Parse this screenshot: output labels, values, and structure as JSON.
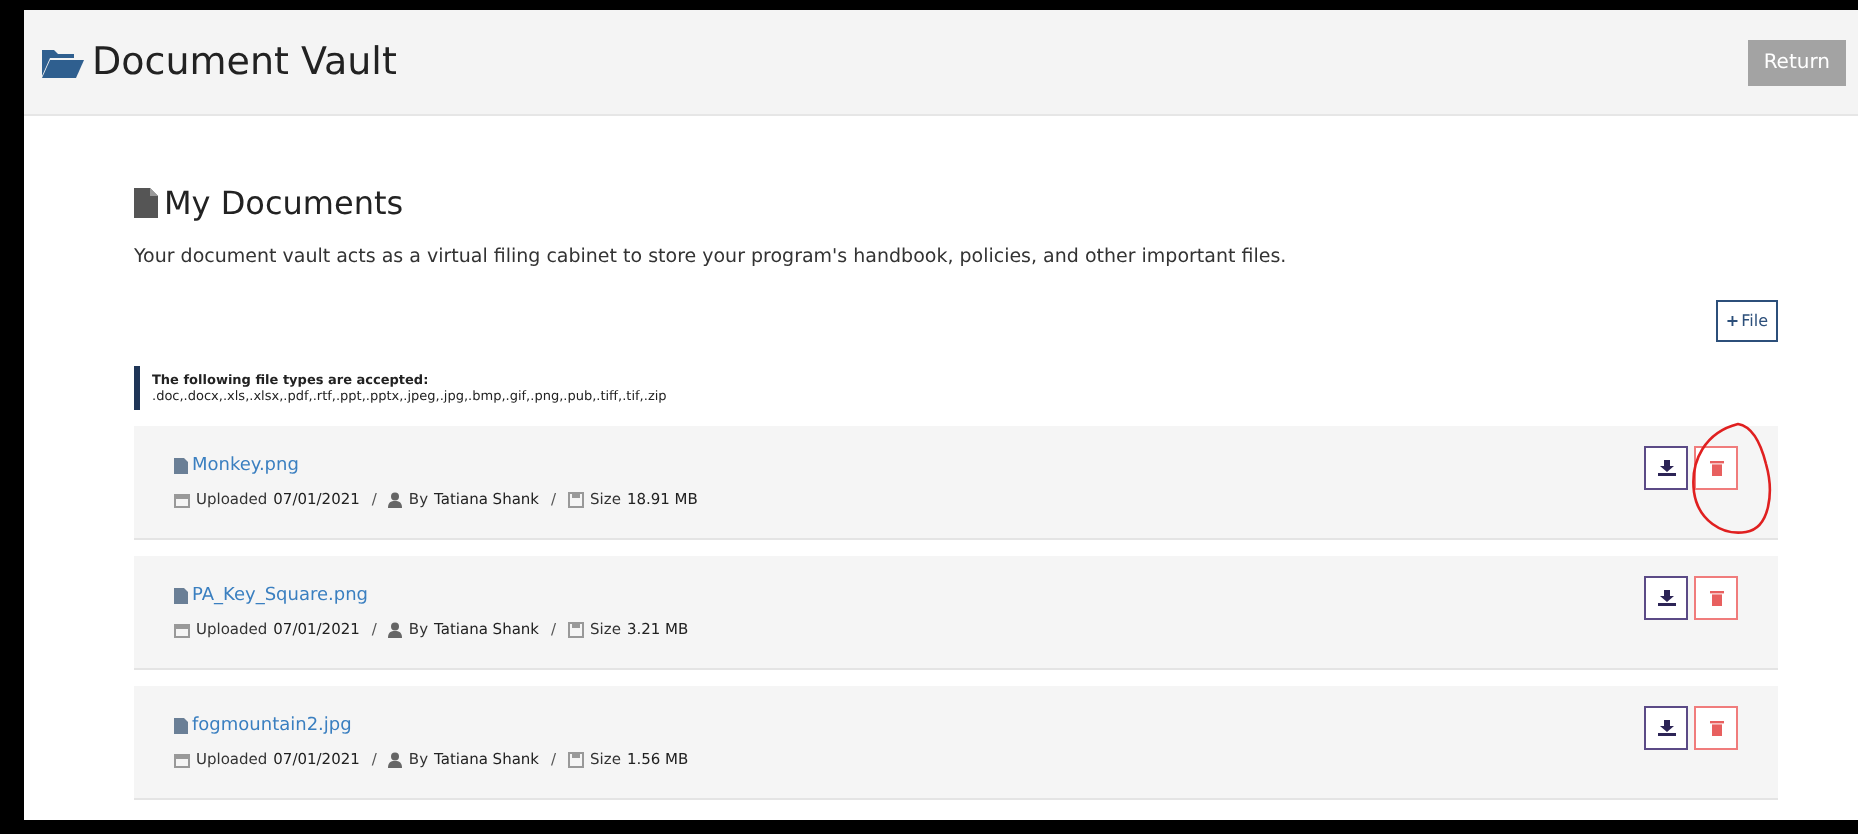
{
  "header": {
    "title": "Document Vault",
    "return_button": "Return"
  },
  "section": {
    "title": "My Documents",
    "description": "Your document vault acts as a virtual filing cabinet to store your program's handbook, policies, and other important files.",
    "add_button": "File",
    "add_symbol": "+"
  },
  "accepted": {
    "heading": "The following file types are accepted:",
    "types": ".doc,.docx,.xls,.xlsx,.pdf,.rtf,.ppt,.pptx,.jpeg,.jpg,.bmp,.gif,.png,.pub,.tiff,.tif,.zip"
  },
  "files": [
    {
      "name": "Monkey.png",
      "uploaded_label": "Uploaded",
      "date": "07/01/2021",
      "by_label": "By",
      "author": "Tatiana Shank",
      "size_label": "Size",
      "size": "18.91 MB",
      "separator": "/",
      "annotated": true
    },
    {
      "name": "PA_Key_Square.png",
      "uploaded_label": "Uploaded",
      "date": "07/01/2021",
      "by_label": "By",
      "author": "Tatiana Shank",
      "size_label": "Size",
      "size": "3.21 MB",
      "separator": "/",
      "annotated": false
    },
    {
      "name": "fogmountain2.jpg",
      "uploaded_label": "Uploaded",
      "date": "07/01/2021",
      "by_label": "By",
      "author": "Tatiana Shank",
      "size_label": "Size",
      "size": "1.56 MB",
      "separator": "/",
      "annotated": false
    }
  ]
}
